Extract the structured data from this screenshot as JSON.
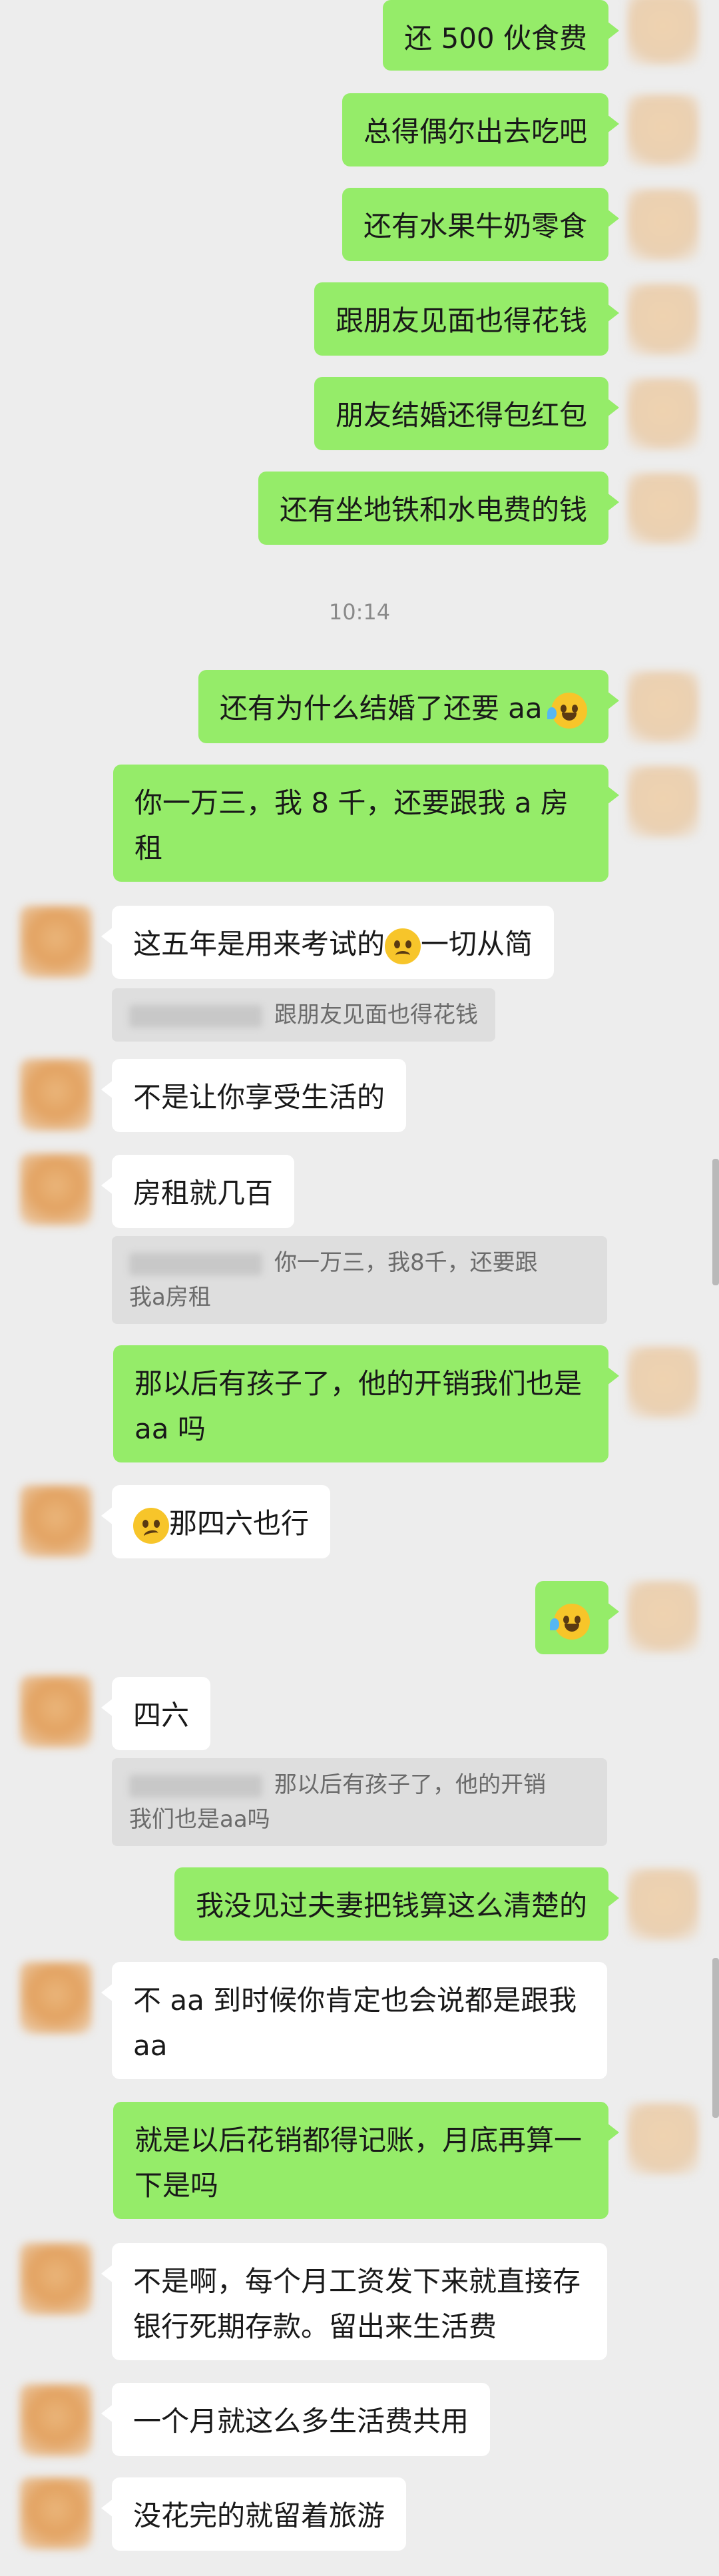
{
  "messages": {
    "m1": "还 500 伙食费",
    "m2": "总得偶尔出去吃吧",
    "m3": "还有水果牛奶零食",
    "m4": "跟朋友见面也得花钱",
    "m5": "朋友结婚还得包红包",
    "m6": "还有坐地铁和水电费的钱",
    "time": "10:14",
    "m7": "还有为什么结婚了还要 aa",
    "m8": "你一万三，我 8 千，还要跟我 a 房租",
    "m9a": "这五年是用来考试的",
    "m9b": "一切从简",
    "q1": "跟朋友见面也得花钱",
    "m10": "不是让你享受生活的",
    "m11": "房租就几百",
    "q2a": "你一万三，我8千，还要跟",
    "q2b": "我a房租",
    "m12": "那以后有孩子了，他的开销我们也是 aa 吗",
    "m13": "那四六也行",
    "m15": "四六",
    "q3a": "那以后有孩子了，他的开销",
    "q3b": "我们也是aa吗",
    "m16": "我没见过夫妻把钱算这么清楚的",
    "m17": "不 aa 到时候你肯定也会说都是跟我 aa",
    "m18": "就是以后花销都得记账，月底再算一下是吗",
    "m19": "不是啊，每个月工资发下来就直接存银行死期存款。留出来生活费",
    "m20": "一个月就这么多生活费共用",
    "m21": "没花完的就留着旅游"
  },
  "colors": {
    "sent_bubble": "#95ec69",
    "received_bubble": "#ffffff",
    "background": "#ededed",
    "quote_bg": "#dedede"
  },
  "icons": [
    "grimacing-laugh-emoji",
    "frowning-emoji",
    "confused-emoji",
    "laugh-crying-emoji"
  ]
}
